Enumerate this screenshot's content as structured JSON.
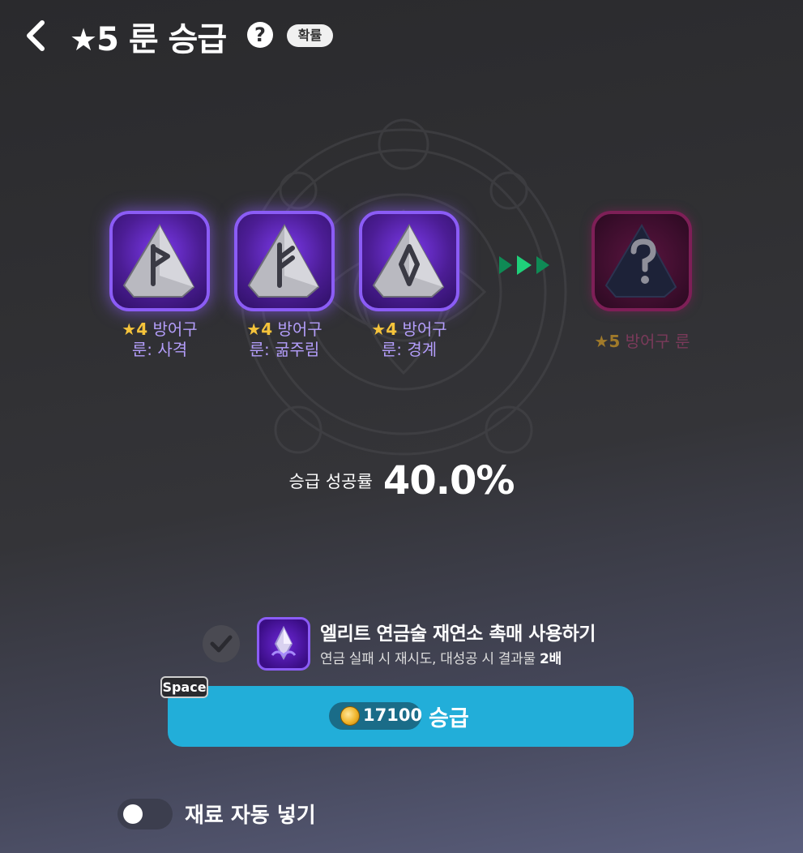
{
  "header": {
    "star_glyph": "★",
    "title": "5 룬 승급",
    "help_glyph": "?",
    "probability_label": "확률"
  },
  "materials": [
    {
      "grade": "★4",
      "line1": "방어구",
      "line2": "룬: 사격",
      "rune_icon": "rune-p-icon"
    },
    {
      "grade": "★4",
      "line1": "방어구",
      "line2": "룬: 굶주림",
      "rune_icon": "rune-f-icon"
    },
    {
      "grade": "★4",
      "line1": "방어구",
      "line2": "룬: 경계",
      "rune_icon": "rune-diamond-icon"
    }
  ],
  "result": {
    "grade": "★5",
    "name": "방어구 룬",
    "icon": "unknown-rune-icon"
  },
  "success_rate": {
    "label": "승급 성공률",
    "value": "40.0%"
  },
  "catalyst": {
    "title": "엘리트 연금술 재연소 촉매 사용하기",
    "desc_prefix": "연금 실패 시 재시도, 대성공 시 결과물 ",
    "desc_bold": "2배"
  },
  "upgrade": {
    "space_key": "Space",
    "cost": "17100",
    "label": "승급"
  },
  "auto_fill": {
    "label": "재료 자동 넣기",
    "enabled": false
  },
  "colors": {
    "accent": "#22aed9",
    "rune_border": "#8b5cf6",
    "grade_star": "#f5c33b"
  }
}
